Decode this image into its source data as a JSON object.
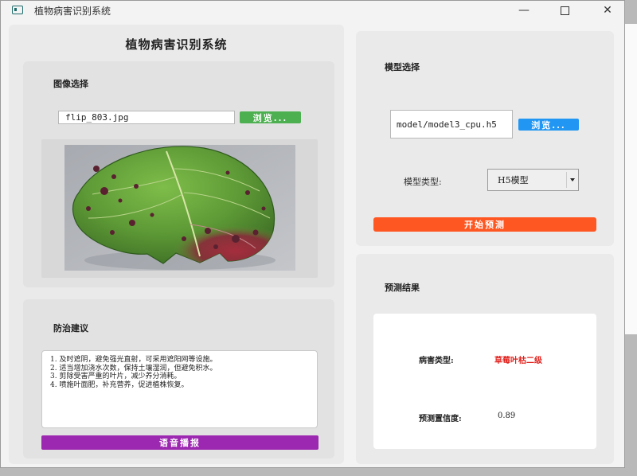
{
  "window": {
    "title": "植物病害识别系统"
  },
  "app": {
    "heading": "植物病害识别系统"
  },
  "image_section": {
    "label": "图像选择",
    "file_value": "flip_803.jpg",
    "browse_label": "浏览..."
  },
  "advice_section": {
    "label": "防治建议",
    "items": [
      "1. 及时遮阴，避免强光直射，可采用遮阳网等设施。",
      "2. 适当增加浇水次数，保持土壤湿润，但避免积水。",
      "3. 剪除受害严重的叶片，减少养分消耗。",
      "4. 喷施叶面肥，补充营养，促进植株恢复。"
    ],
    "speak_label": "语音播报"
  },
  "model_section": {
    "label": "模型选择",
    "path_value": "model/model3_cpu.h5",
    "browse_label": "浏览...",
    "type_label": "模型类型:",
    "type_selected": "H5模型",
    "predict_label": "开始预测"
  },
  "result_section": {
    "label": "预测结果",
    "disease_label": "病害类型:",
    "disease_value": "草莓叶枯二级",
    "confidence_label": "预测置信度:",
    "confidence_value": "0.89"
  },
  "colors": {
    "green_button": "#4caf50",
    "blue_button": "#2196f3",
    "orange_button": "#ff5722",
    "purple_button": "#9c27b0",
    "disease_red": "#e0201b"
  }
}
